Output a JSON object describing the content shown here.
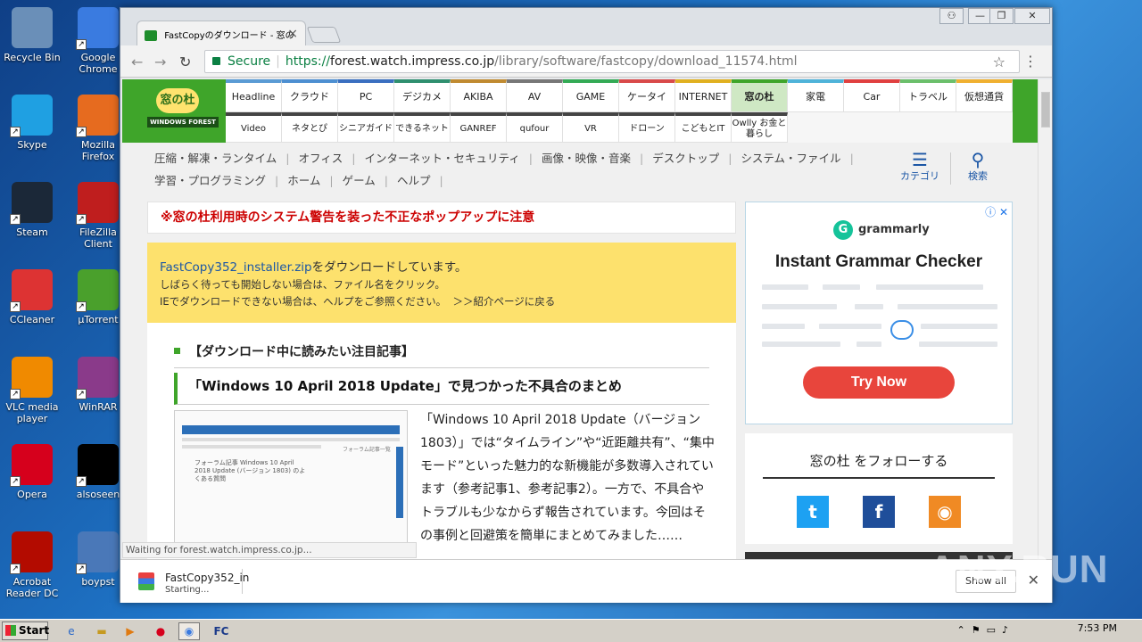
{
  "desktop_icons": [
    {
      "label": "Recycle Bin",
      "icon": "recycle-bin-icon",
      "color": "#6a8fb8"
    },
    {
      "label": "Google Chrome",
      "icon": "chrome-icon",
      "color": "#3a7be0"
    },
    {
      "label": "Skype",
      "icon": "skype-icon",
      "color": "#1fa0e2"
    },
    {
      "label": "Mozilla Firefox",
      "icon": "firefox-icon",
      "color": "#e66b1f"
    },
    {
      "label": "Steam",
      "icon": "steam-icon",
      "color": "#1b2838"
    },
    {
      "label": "FileZilla Client",
      "icon": "filezilla-icon",
      "color": "#bf1e1e"
    },
    {
      "label": "CCleaner",
      "icon": "ccleaner-icon",
      "color": "#d33"
    },
    {
      "label": "µTorrent",
      "icon": "utorrent-icon",
      "color": "#4aa02c"
    },
    {
      "label": "VLC media player",
      "icon": "vlc-icon",
      "color": "#f08a00"
    },
    {
      "label": "WinRAR",
      "icon": "winrar-icon",
      "color": "#8a3a8a"
    },
    {
      "label": "Opera",
      "icon": "opera-icon",
      "color": "#d6001c"
    },
    {
      "label": "alsoseen",
      "icon": "file-icon",
      "color": "#000000"
    },
    {
      "label": "Acrobat Reader DC",
      "icon": "acrobat-icon",
      "color": "#b30b00"
    },
    {
      "label": "boypst",
      "icon": "file-icon",
      "color": "#4a78b8"
    }
  ],
  "browser": {
    "tab_title": "FastCopyのダウンロード - 窓の",
    "tab_close": "×",
    "window_controls": [
      "⚇",
      "—",
      "❐",
      "✕"
    ],
    "url_secure": "Secure",
    "url_scheme": "https://",
    "url_host": "forest.watch.impress.co.jp",
    "url_path": "/library/software/fastcopy/download_11574.html",
    "status_text": "Waiting for forest.watch.impress.co.jp..."
  },
  "site": {
    "logo_text": "窓の杜",
    "logo_sub": "WINDOWS FOREST",
    "nav_row1": [
      {
        "label": "Headline",
        "color": "#5a9bd4"
      },
      {
        "label": "クラウド",
        "color": "#4d8fd1"
      },
      {
        "label": "PC",
        "color": "#3a6fc0"
      },
      {
        "label": "デジカメ",
        "color": "#2f8f6f"
      },
      {
        "label": "AKIBA",
        "color": "#c08a30"
      },
      {
        "label": "AV",
        "color": "#777777"
      },
      {
        "label": "GAME",
        "color": "#33aa55"
      },
      {
        "label": "ケータイ",
        "color": "#d94a4a"
      },
      {
        "label": "INTERNET",
        "color": "#e0b020"
      },
      {
        "label": "窓の杜",
        "color": "#3fa52a"
      },
      {
        "label": "家電",
        "color": "#4fb3d9"
      },
      {
        "label": "Car",
        "color": "#e04040"
      },
      {
        "label": "トラベル",
        "color": "#6bbf6b"
      },
      {
        "label": "仮想通貨",
        "color": "#f0b030"
      }
    ],
    "nav_row2": [
      {
        "label": "Video",
        "color": "#444444"
      },
      {
        "label": "ネタとぴ",
        "color": "#444444"
      },
      {
        "label": "シニアガイド",
        "color": "#444444"
      },
      {
        "label": "できるネット",
        "color": "#444444"
      },
      {
        "label": "GANREF",
        "color": "#444444"
      },
      {
        "label": "qufour",
        "color": "#444444"
      },
      {
        "label": "VR",
        "color": "#444444"
      },
      {
        "label": "ドローン",
        "color": "#444444"
      },
      {
        "label": "こどもとIT",
        "color": "#444444"
      },
      {
        "label": "Owlly お金と暮らし",
        "color": "#444444"
      }
    ],
    "categories_row1": [
      "圧縮・解凍・ランタイム",
      "オフィス",
      "インターネット・セキュリティ",
      "画像・映像・音楽",
      "デスクトップ",
      "システム・ファイル"
    ],
    "categories_row2": [
      "学習・プログラミング",
      "ホーム",
      "ゲーム",
      "ヘルプ"
    ],
    "category_menu_label": "カテゴリ",
    "search_label": "検索",
    "alert_text": "※窓の杜利用時のシステム警告を装った不正なポップアップに注意",
    "download": {
      "filename": "FastCopy352_installer.zip",
      "downloading_suffix": "をダウンロードしています。",
      "line2": "しばらく待っても開始しない場合は、ファイル名をクリック。",
      "line3": "IEでダウンロードできない場合は、ヘルプをご参照ください。",
      "back_link": "＞＞紹介ページに戻る"
    },
    "article": {
      "section_title": "【ダウンロード中に読みたい注目記事】",
      "headline": "「Windows 10 April 2018 Update」で見つかった不具合のまとめ",
      "body": "「Windows 10 April 2018 Update（バージョン 1803）」では“タイムライン”や“近距離共有”、“集中モード”といった魅力的な新機能が多数導入されています（参考記事1、参考記事2）。一方で、不具合やトラブルも少なからず報告されています。今回はその事例と回避策を簡単にまとめてみました……",
      "thumb_title": "フォーラム記事 Windows 10 April 2018 Update (バージョン 1803) のよくある質問",
      "thumb_side": "フォーラム記事一覧"
    },
    "ad": {
      "brand": "grammarly",
      "headline": "Instant Grammar Checker",
      "cta": "Try Now",
      "info_icons": "ⓘ ✕"
    },
    "follow": {
      "title": "窓の杜 をフォローする",
      "twitter": "t",
      "facebook": "f",
      "rss": "◉"
    }
  },
  "download_shelf": {
    "filename": "FastCopy352_in",
    "status": "Starting...",
    "show_all": "Show all",
    "close": "✕"
  },
  "watermark": "ANY.RUN",
  "taskbar": {
    "start_label": "Start",
    "clock": "7:53 PM"
  }
}
